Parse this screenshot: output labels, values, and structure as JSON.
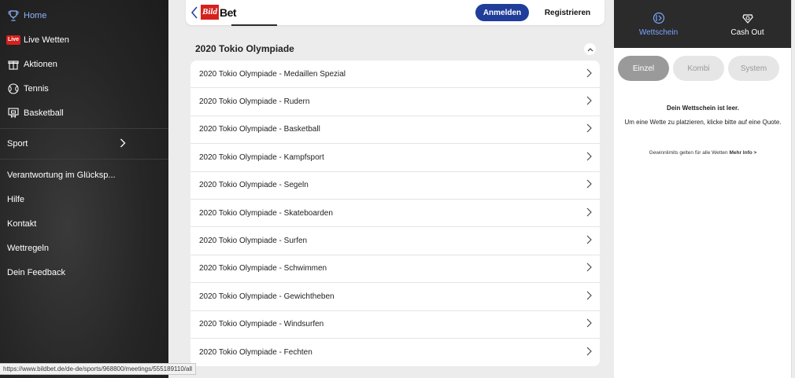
{
  "sidebar": {
    "top_items": [
      {
        "label": "Home",
        "icon": "trophy-icon"
      },
      {
        "label": "Live Wetten",
        "icon": "live-badge-icon",
        "badge": "Live"
      },
      {
        "label": "Aktionen",
        "icon": "gift-icon"
      },
      {
        "label": "Tennis",
        "icon": "tennis-ball-icon"
      },
      {
        "label": "Basketball",
        "icon": "basketball-hoop-icon"
      }
    ],
    "sport_label": "Sport",
    "bottom_items": [
      {
        "label": "Verantwortung im Glücksp..."
      },
      {
        "label": "Hilfe"
      },
      {
        "label": "Kontakt"
      },
      {
        "label": "Wettregeln"
      },
      {
        "label": "Dein Feedback"
      }
    ]
  },
  "header": {
    "logo_left": "Bild",
    "logo_right": "Bet",
    "login_label": "Anmelden",
    "register_label": "Registrieren"
  },
  "main": {
    "section_title": "2020 Tokio Olympiade",
    "items": [
      "2020 Tokio Olympiade - Medaillen Spezial",
      "2020 Tokio Olympiade - Rudern",
      "2020 Tokio Olympiade - Basketball",
      "2020 Tokio Olympiade - Kampfsport",
      "2020 Tokio Olympiade - Segeln",
      "2020 Tokio Olympiade - Skateboarden",
      "2020 Tokio Olympiade - Surfen",
      "2020 Tokio Olympiade - Schwimmen",
      "2020 Tokio Olympiade - Gewichtheben",
      "2020 Tokio Olympiade - Windsurfen",
      "2020 Tokio Olympiade - Fechten"
    ]
  },
  "betslip": {
    "tabs": [
      {
        "label": "Wettschein",
        "icon": "betslip-icon"
      },
      {
        "label": "Cash Out",
        "icon": "cash-out-icon"
      }
    ],
    "modes": [
      "Einzel",
      "Kombi",
      "System"
    ],
    "empty_title": "Dein Wettschein ist leer.",
    "empty_text": "Um eine Wette zu platzieren, klicke bitte auf eine Quote.",
    "limits_text": "Gewinnlimits gelten für alle Wetten",
    "limits_link": "Mehr Info >"
  },
  "status_url": "https://www.bildbet.de/de-de/sports/968800/meetings/555189110/all",
  "colors": {
    "accent": "#1f3d99",
    "active_tab": "#7aa5ff",
    "live_badge": "#d5211e"
  }
}
